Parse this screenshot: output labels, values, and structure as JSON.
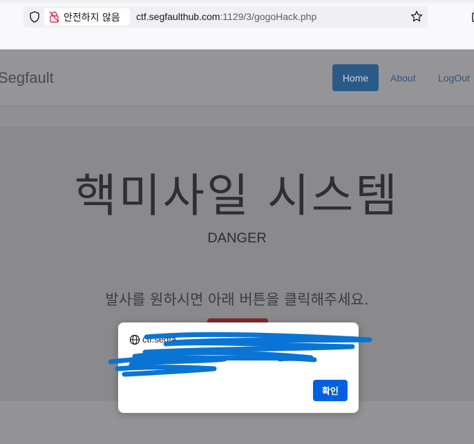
{
  "browser": {
    "security_label": "안전하지 않음",
    "url_host": "ctf.segfaulthub.com",
    "url_rest": ":1129/3/gogoHack.php"
  },
  "navbar": {
    "brand": "Segfault",
    "items": [
      {
        "label": "Home",
        "active": true
      },
      {
        "label": "About"
      },
      {
        "label": "LogOut"
      }
    ]
  },
  "hero": {
    "title": "핵미사일 시스템",
    "subtitle": "DANGER",
    "text": "발사를 원하시면 아래 버튼을 클릭해주세요."
  },
  "dialog": {
    "origin": "ctf.segfa",
    "ok_label": "확인"
  },
  "colors": {
    "home_button": "#2b5a87",
    "fire_button": "#7e2c2f",
    "ok_button": "#0061e0",
    "redaction_scribble": "#0a74d4"
  }
}
